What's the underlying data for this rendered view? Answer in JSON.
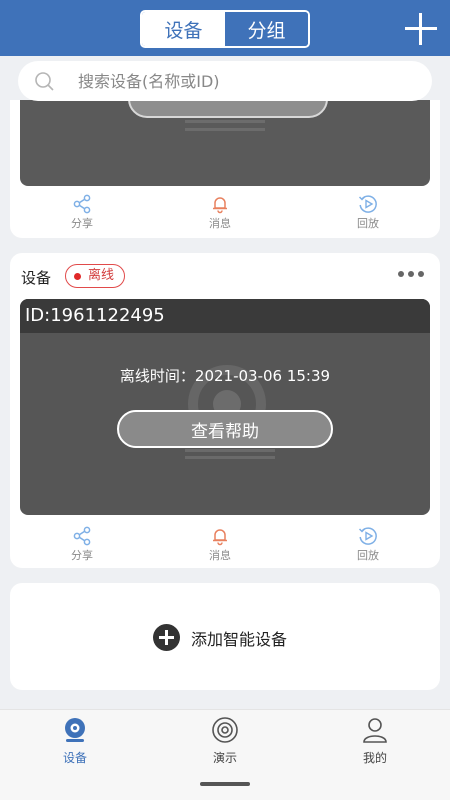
{
  "header": {
    "tabs": [
      {
        "label": "设备",
        "active": true
      },
      {
        "label": "分组",
        "active": false
      }
    ],
    "add_icon": "plus-icon"
  },
  "search": {
    "placeholder": "搜索设备(名称或ID)",
    "value": ""
  },
  "devices": [
    {
      "actions": [
        {
          "label": "分享",
          "icon": "share-icon"
        },
        {
          "label": "消息",
          "icon": "bell-icon"
        },
        {
          "label": "回放",
          "icon": "playback-icon"
        }
      ]
    },
    {
      "name": "设备",
      "status": "离线",
      "id_text": "ID:1961122495",
      "offline_time": "离线时间：2021-03-06 15:39",
      "help_label": "查看帮助",
      "actions": [
        {
          "label": "分享",
          "icon": "share-icon"
        },
        {
          "label": "消息",
          "icon": "bell-icon"
        },
        {
          "label": "回放",
          "icon": "playback-icon"
        }
      ]
    }
  ],
  "add_device": {
    "label": "添加智能设备"
  },
  "tabbar": {
    "items": [
      {
        "label": "设备",
        "active": true,
        "icon": "camera-icon"
      },
      {
        "label": "演示",
        "active": false,
        "icon": "demo-icon"
      },
      {
        "label": "我的",
        "active": false,
        "icon": "user-icon"
      }
    ]
  },
  "colors": {
    "brand": "#3f72b9",
    "offline": "#e02828",
    "bell": "#e8805e",
    "action_icon": "#7fb0e6"
  }
}
